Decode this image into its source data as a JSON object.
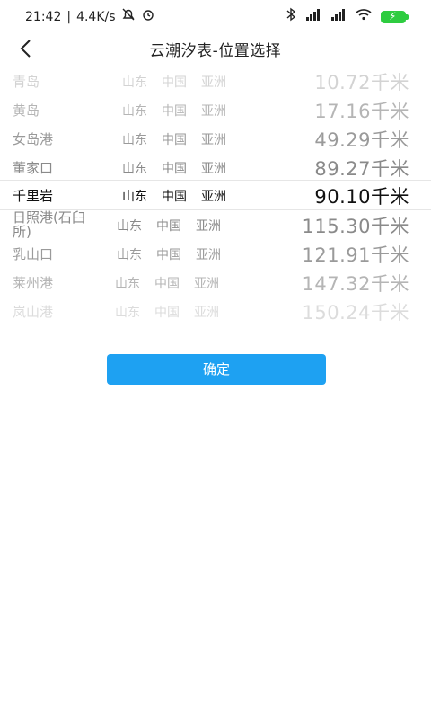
{
  "status_bar": {
    "time": "21:42",
    "speed": "4.4K/s",
    "icons": [
      "notification-off-icon",
      "alarm-icon",
      "bluetooth-icon",
      "signal-icon",
      "signal-icon",
      "wifi-icon",
      "battery-charging-icon"
    ]
  },
  "header": {
    "title": "云潮汐表-位置选择",
    "back_icon": "chevron-left-icon"
  },
  "picker": {
    "items": [
      {
        "name": "青岛",
        "province": "山东",
        "country": "中国",
        "continent": "亚洲",
        "distance": "10.72千米"
      },
      {
        "name": "黄岛",
        "province": "山东",
        "country": "中国",
        "continent": "亚洲",
        "distance": "17.16千米"
      },
      {
        "name": "女岛港",
        "province": "山东",
        "country": "中国",
        "continent": "亚洲",
        "distance": "49.29千米"
      },
      {
        "name": "董家口",
        "province": "山东",
        "country": "中国",
        "continent": "亚洲",
        "distance": "89.27千米"
      },
      {
        "name": "千里岩",
        "province": "山东",
        "country": "中国",
        "continent": "亚洲",
        "distance": "90.10千米"
      },
      {
        "name": "日照港(石臼所)",
        "province": "山东",
        "country": "中国",
        "continent": "亚洲",
        "distance": "115.30千米"
      },
      {
        "name": "乳山口",
        "province": "山东",
        "country": "中国",
        "continent": "亚洲",
        "distance": "121.91千米"
      },
      {
        "name": "莱州港",
        "province": "山东",
        "country": "中国",
        "continent": "亚洲",
        "distance": "147.32千米"
      },
      {
        "name": "岚山港",
        "province": "山东",
        "country": "中国",
        "continent": "亚洲",
        "distance": "150.24千米"
      }
    ]
  },
  "confirm_label": "确定"
}
